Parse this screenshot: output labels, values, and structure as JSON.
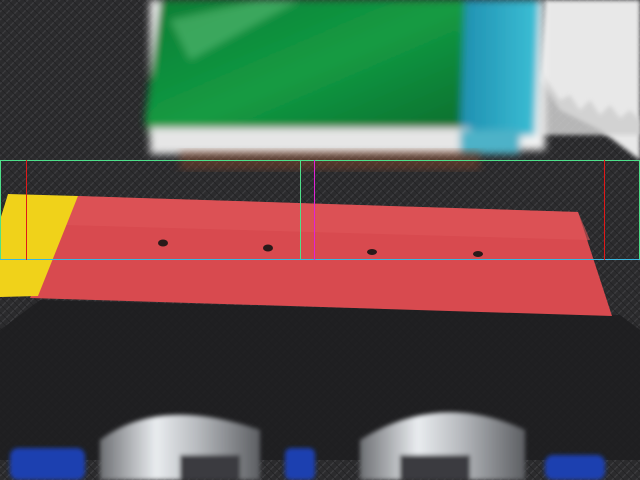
{
  "scene": {
    "description_tag": "camera-frame",
    "colors": {
      "belt": "#2b2b2d",
      "belt_weave": "#3a3a3d",
      "red_tape": "#d84a4f",
      "yellow_tape": "#f0d21a",
      "green_object": "#0e8a3a",
      "cyan_object": "#2aa9c4",
      "roi_green": "#4ee08a",
      "roi_cyan": "#35c7d8",
      "marker_red": "#e01818",
      "marker_magenta": "#e021d6",
      "white_wall": "#e8e8e8"
    },
    "overlay": {
      "roi_count": 2,
      "marker_lines": 3
    }
  }
}
